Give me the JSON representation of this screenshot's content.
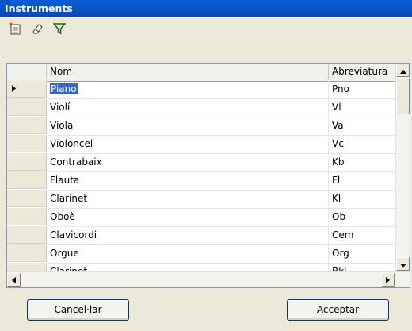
{
  "window": {
    "title": "Instruments"
  },
  "toolbar": {
    "buttons": [
      {
        "icon": "new-record-icon"
      },
      {
        "icon": "eraser-icon"
      },
      {
        "icon": "filter-icon"
      }
    ]
  },
  "grid": {
    "columns": [
      "Nom",
      "Abreviatura"
    ],
    "rows": [
      {
        "nom": "Piano",
        "abr": "Pno",
        "selected": true
      },
      {
        "nom": "Violí",
        "abr": "Vl"
      },
      {
        "nom": "Viola",
        "abr": "Va"
      },
      {
        "nom": "Violoncel",
        "abr": "Vc"
      },
      {
        "nom": "Contrabaix",
        "abr": "Kb"
      },
      {
        "nom": "Flauta",
        "abr": "Fl"
      },
      {
        "nom": "Clarinet",
        "abr": "Kl"
      },
      {
        "nom": "Oboè",
        "abr": "Ob"
      },
      {
        "nom": "Clavicordi",
        "abr": "Cem"
      },
      {
        "nom": "Orgue",
        "abr": "Org"
      },
      {
        "nom": "Clarinet",
        "abr": "Bkl"
      }
    ]
  },
  "footer": {
    "cancel_label": "Cancel·lar",
    "accept_label": "Acceptar"
  },
  "colors": {
    "title_bar": "#0a52c8",
    "selection": "#316ac5",
    "window_bg": "#ece9d8"
  }
}
